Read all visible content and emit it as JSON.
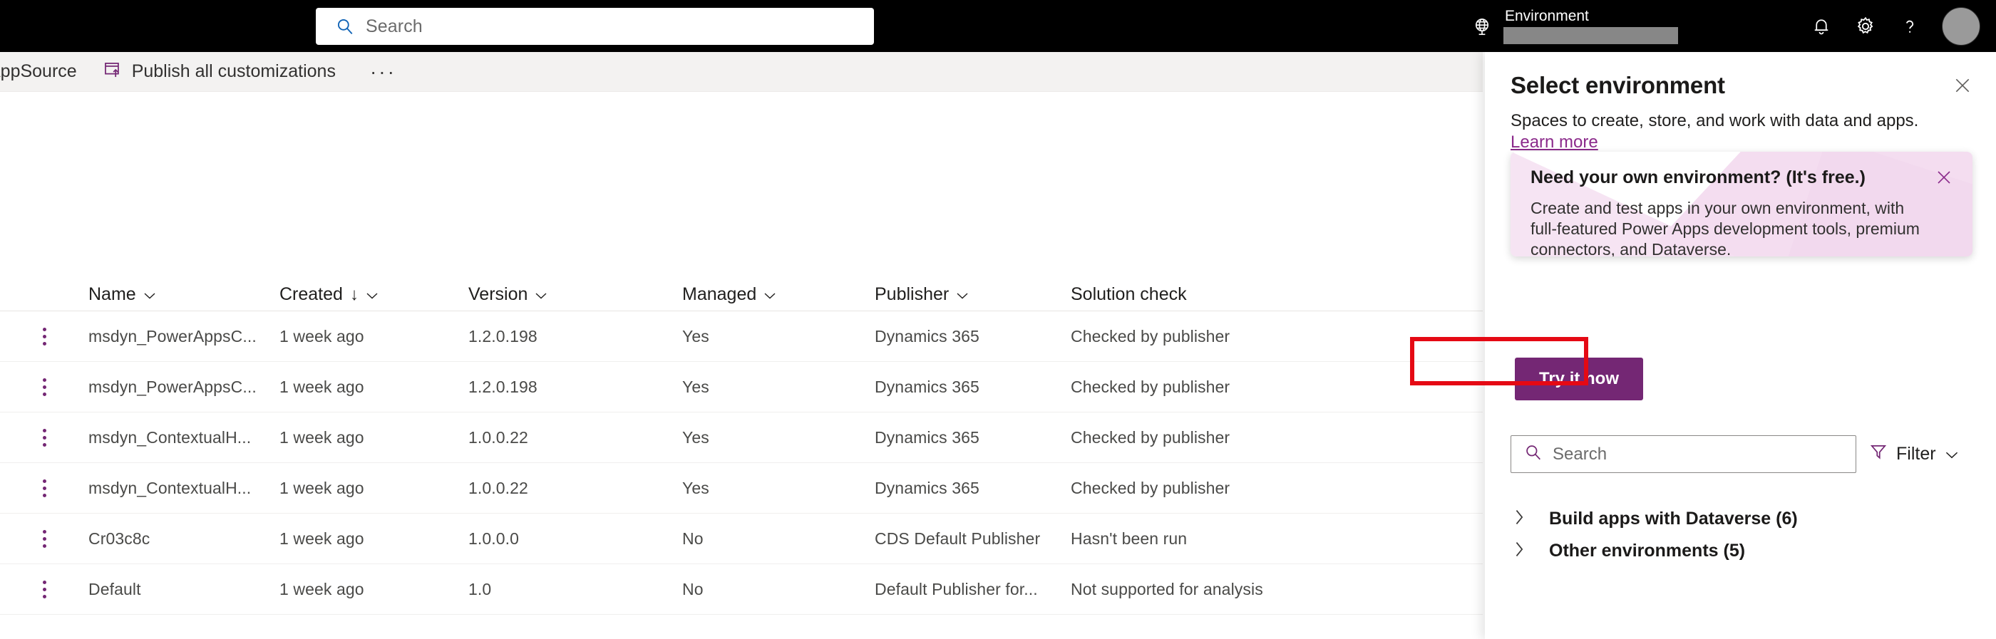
{
  "header": {
    "search_placeholder": "Search",
    "environment_label": "Environment",
    "environment_value": "",
    "icons": {
      "globe": "globe-icon",
      "bell": "notification-bell-icon",
      "gear": "settings-gear-icon",
      "help": "help-question-icon",
      "avatar": "user-avatar"
    }
  },
  "command_bar": {
    "appsource_label": "AppSource",
    "publish_label": "Publish all customizations",
    "overflow_label": "···"
  },
  "table": {
    "columns": [
      {
        "label": "Name",
        "sortable": true,
        "sorted": false
      },
      {
        "label": "Created",
        "sortable": true,
        "sorted": true,
        "sort_dir": "↓"
      },
      {
        "label": "Version",
        "sortable": true,
        "sorted": false
      },
      {
        "label": "Managed",
        "sortable": true,
        "sorted": false
      },
      {
        "label": "Publisher",
        "sortable": true,
        "sorted": false
      },
      {
        "label": "Solution check",
        "sortable": false,
        "sorted": false
      }
    ],
    "rows": [
      {
        "name": "msdyn_PowerAppsC...",
        "created": "1 week ago",
        "version": "1.2.0.198",
        "managed": "Yes",
        "publisher": "Dynamics 365",
        "solution_check": "Checked by publisher"
      },
      {
        "name": "msdyn_PowerAppsC...",
        "created": "1 week ago",
        "version": "1.2.0.198",
        "managed": "Yes",
        "publisher": "Dynamics 365",
        "solution_check": "Checked by publisher"
      },
      {
        "name": "msdyn_ContextualH...",
        "created": "1 week ago",
        "version": "1.0.0.22",
        "managed": "Yes",
        "publisher": "Dynamics 365",
        "solution_check": "Checked by publisher"
      },
      {
        "name": "msdyn_ContextualH...",
        "created": "1 week ago",
        "version": "1.0.0.22",
        "managed": "Yes",
        "publisher": "Dynamics 365",
        "solution_check": "Checked by publisher"
      },
      {
        "name": "Cr03c8c",
        "created": "1 week ago",
        "version": "1.0.0.0",
        "managed": "No",
        "publisher": "CDS Default Publisher",
        "solution_check": "Hasn't been run"
      },
      {
        "name": "Default",
        "created": "1 week ago",
        "version": "1.0",
        "managed": "No",
        "publisher": "Default Publisher for...",
        "solution_check": "Not supported for analysis"
      }
    ]
  },
  "panel": {
    "title": "Select environment",
    "subtitle": "Spaces to create, store, and work with data and apps.",
    "learn_more": "Learn more",
    "callout": {
      "title": "Need your own environment? (It's free.)",
      "body": "Create and test apps in your own environment, with full-featured Power Apps development tools, premium connectors, and Dataverse.",
      "cta": "Try it now"
    },
    "search_placeholder": "Search",
    "filter_label": "Filter",
    "groups": [
      {
        "label": "Build apps with Dataverse (6)",
        "expanded": false
      },
      {
        "label": "Other environments (5)",
        "expanded": false
      }
    ]
  },
  "colors": {
    "brand_purple": "#742774",
    "link_purple": "#8b2a8b",
    "header_black": "#000000",
    "command_bar_bg": "#f3f2f1",
    "highlight_red": "#e50914",
    "callout_pink": "#edc8e6"
  }
}
